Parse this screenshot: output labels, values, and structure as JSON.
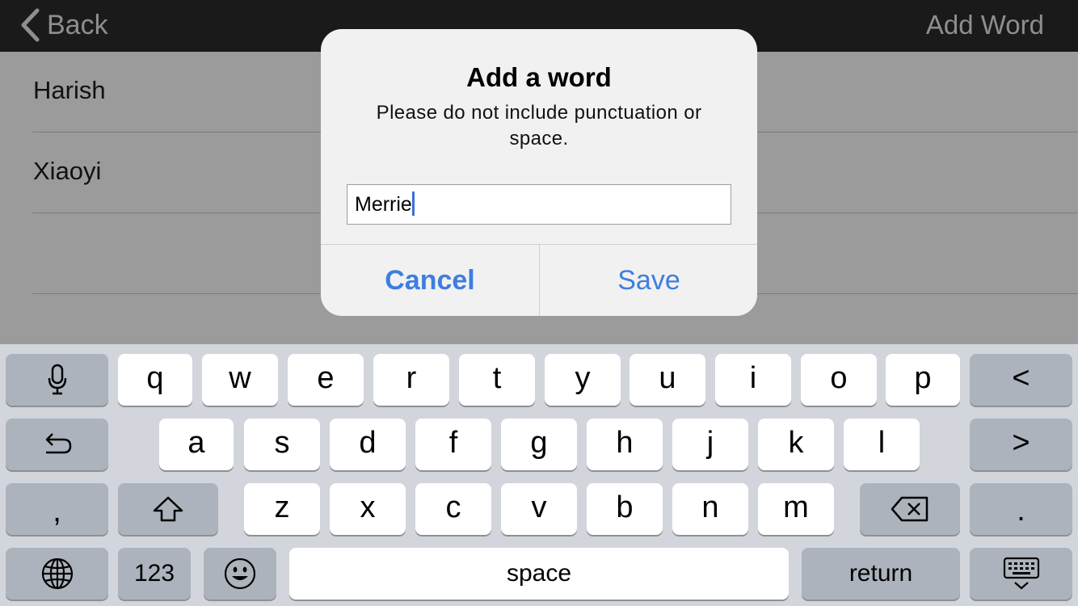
{
  "nav": {
    "back_label": "Back",
    "title": "Add Word"
  },
  "list": {
    "rows": [
      "Harish",
      "Xiaoyi",
      ""
    ]
  },
  "dialog": {
    "title": "Add a word",
    "message": "Please do not include punctuation or space.",
    "input_value": "Merrie",
    "cancel_label": "Cancel",
    "save_label": "Save"
  },
  "keyboard": {
    "row1": [
      "q",
      "w",
      "e",
      "r",
      "t",
      "y",
      "u",
      "i",
      "o",
      "p"
    ],
    "row2": [
      "a",
      "s",
      "d",
      "f",
      "g",
      "h",
      "j",
      "k",
      "l"
    ],
    "row3": [
      "z",
      "x",
      "c",
      "v",
      "b",
      "n",
      "m"
    ],
    "left_arrow": "<",
    "right_arrow": ">",
    "comma": ",",
    "period": ".",
    "numbers_label": "123",
    "space_label": "space",
    "return_label": "return"
  },
  "colors": {
    "accent": "#3d7ee0",
    "navbar": "#1a1a1a",
    "keyboard_bg": "#d2d5db"
  }
}
